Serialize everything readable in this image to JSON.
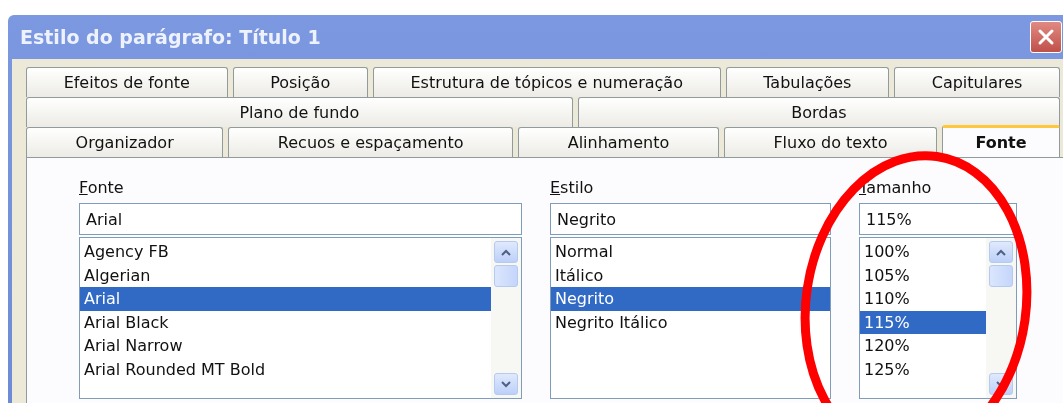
{
  "window": {
    "title": "Estilo do parágrafo: Título 1"
  },
  "tab_rows": [
    [
      {
        "label": "Efeitos de fonte",
        "selected": false
      },
      {
        "label": "Posição",
        "selected": false
      },
      {
        "label": "Estrutura de tópicos e numeração",
        "selected": false
      },
      {
        "label": "Tabulações",
        "selected": false
      },
      {
        "label": "Capitulares",
        "selected": false
      }
    ],
    [
      {
        "label": "Plano de fundo",
        "selected": false
      },
      {
        "label": "Bordas",
        "selected": false
      }
    ],
    [
      {
        "label": "Organizador",
        "selected": false
      },
      {
        "label": "Recuos e espaçamento",
        "selected": false
      },
      {
        "label": "Alinhamento",
        "selected": false
      },
      {
        "label": "Fluxo do texto",
        "selected": false
      },
      {
        "label": "Fonte",
        "selected": true
      }
    ]
  ],
  "columns": [
    {
      "label": "Fonte",
      "value": "Arial",
      "scrollbar": true,
      "items": [
        {
          "label": "Agency FB",
          "selected": false
        },
        {
          "label": "Algerian",
          "selected": false
        },
        {
          "label": "Arial",
          "selected": true
        },
        {
          "label": "Arial Black",
          "selected": false
        },
        {
          "label": "Arial Narrow",
          "selected": false
        },
        {
          "label": "Arial Rounded MT Bold",
          "selected": false
        }
      ]
    },
    {
      "label": "Estilo",
      "value": "Negrito",
      "scrollbar": false,
      "items": [
        {
          "label": "Normal",
          "selected": false
        },
        {
          "label": "Itálico",
          "selected": false
        },
        {
          "label": "Negrito",
          "selected": true
        },
        {
          "label": "Negrito Itálico",
          "selected": false
        }
      ]
    },
    {
      "label": "Tamanho",
      "value": "115%",
      "scrollbar": true,
      "items": [
        {
          "label": "100%",
          "selected": false
        },
        {
          "label": "105%",
          "selected": false
        },
        {
          "label": "110%",
          "selected": false
        },
        {
          "label": "115%",
          "selected": true
        },
        {
          "label": "120%",
          "selected": false
        },
        {
          "label": "125%",
          "selected": false
        }
      ]
    }
  ],
  "annotation": {
    "kind": "ellipse",
    "color": "#ff0000"
  }
}
